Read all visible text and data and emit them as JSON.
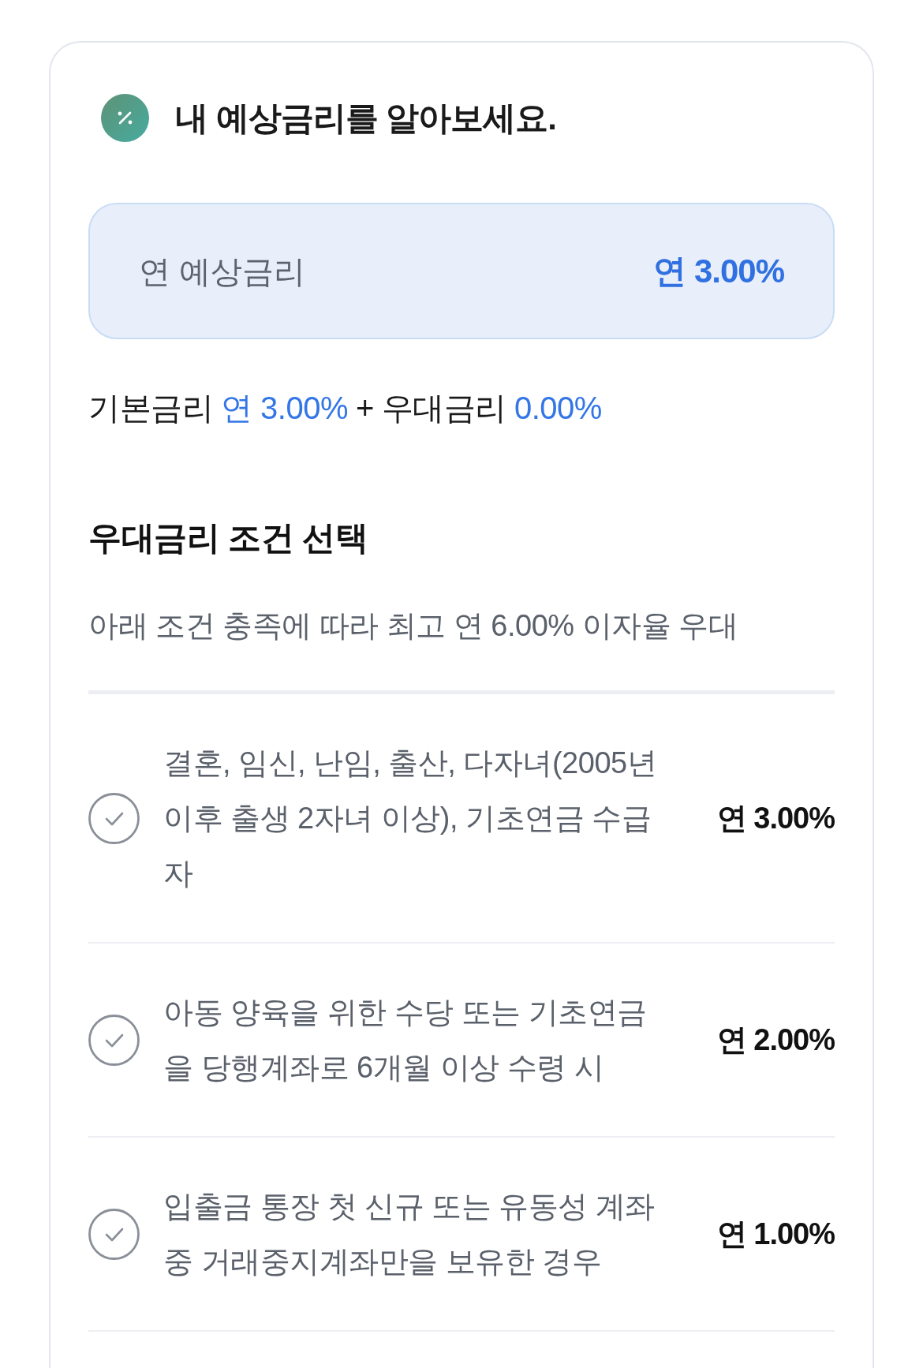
{
  "header": {
    "title": "내 예상금리를 알아보세요."
  },
  "estimate": {
    "label": "연 예상금리",
    "value": "연 3.00%"
  },
  "breakdown": {
    "base_label": "기본금리",
    "base_value": "연 3.00%",
    "operator": "+",
    "bonus_label": "우대금리",
    "bonus_value": "0.00%"
  },
  "conditions": {
    "title": "우대금리 조건 선택",
    "description": "아래 조건 충족에 따라 최고 연 6.00% 이자율 우대",
    "items": [
      {
        "text": "결혼, 임신, 난임, 출산, 다자녀(2005년 이후 출생 2자녀 이상), 기초연금 수급자",
        "rate": "연 3.00%",
        "selected": false
      },
      {
        "text": "아동 양육을 위한 수당 또는 기초연금을 당행계좌로 6개월 이상 수령 시",
        "rate": "연 2.00%",
        "selected": false
      },
      {
        "text": "입출금 통장 첫 신규 또는 유동성 계좌 중 거래중지계좌만을 보유한 경우",
        "rate": "연 1.00%",
        "selected": false
      }
    ]
  }
}
